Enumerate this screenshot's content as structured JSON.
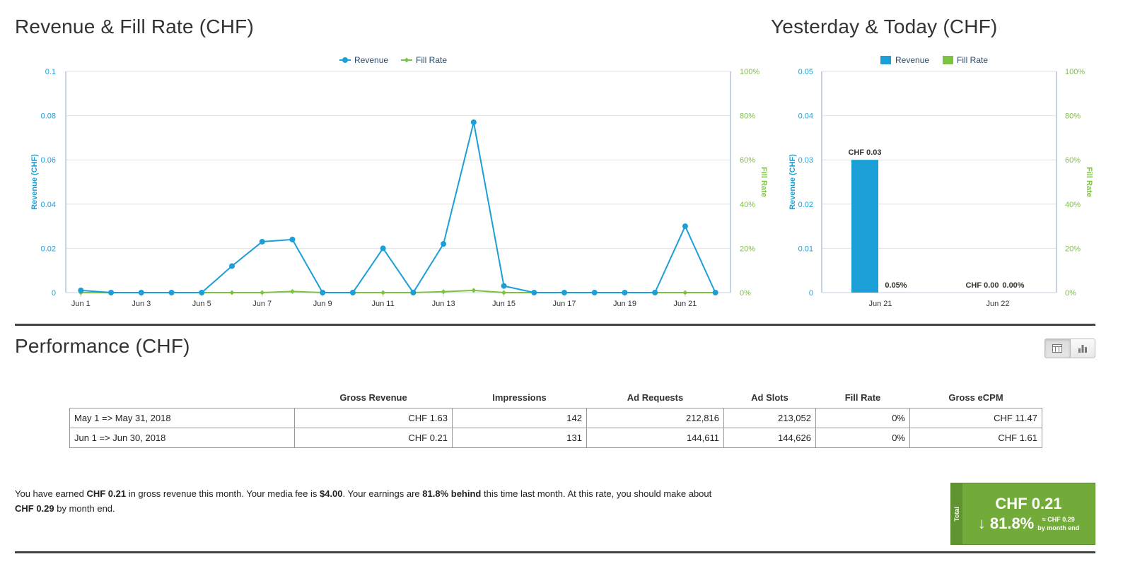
{
  "sections": {
    "revenue_chart_title": "Revenue & Fill Rate (CHF)",
    "yesterday_chart_title": "Yesterday & Today (CHF)",
    "performance_title": "Performance (CHF)"
  },
  "chart_data": [
    {
      "type": "line",
      "title": "Revenue & Fill Rate (CHF)",
      "x": [
        "Jun 1",
        "Jun 2",
        "Jun 3",
        "Jun 4",
        "Jun 5",
        "Jun 6",
        "Jun 7",
        "Jun 8",
        "Jun 9",
        "Jun 10",
        "Jun 11",
        "Jun 12",
        "Jun 13",
        "Jun 14",
        "Jun 15",
        "Jun 16",
        "Jun 17",
        "Jun 18",
        "Jun 19",
        "Jun 20",
        "Jun 21",
        "Jun 22"
      ],
      "x_tick_labels": [
        "Jun 1",
        "Jun 3",
        "Jun 5",
        "Jun 7",
        "Jun 9",
        "Jun 11",
        "Jun 13",
        "Jun 15",
        "Jun 17",
        "Jun 19",
        "Jun 21"
      ],
      "series": [
        {
          "name": "Revenue",
          "axis": "left",
          "color": "#1c9fd7",
          "values": [
            0.001,
            0,
            0,
            0,
            0,
            0.012,
            0.023,
            0.024,
            0,
            0,
            0.02,
            0,
            0.022,
            0.077,
            0.003,
            0,
            0,
            0,
            0,
            0,
            0.03,
            0
          ]
        },
        {
          "name": "Fill Rate",
          "axis": "right",
          "color": "#7dc243",
          "values": [
            0,
            0,
            0,
            0,
            0,
            0,
            0,
            0.5,
            0,
            0,
            0,
            0,
            0.4,
            1.0,
            0,
            0,
            0,
            0,
            0,
            0,
            0,
            0
          ]
        }
      ],
      "ylabel": "Revenue (CHF)",
      "ylim": [
        0,
        0.1
      ],
      "y_tick_labels": [
        "0",
        "0.02",
        "0.04",
        "0.06",
        "0.08",
        "0.1"
      ],
      "y2label": "Fill Rate",
      "y2lim": [
        0,
        100
      ],
      "y2_tick_labels": [
        "0%",
        "20%",
        "40%",
        "60%",
        "80%",
        "100%"
      ],
      "grid": true,
      "legend_position": "top-center"
    },
    {
      "type": "bar",
      "title": "Yesterday & Today (CHF)",
      "categories": [
        "Jun 21",
        "Jun 22"
      ],
      "series": [
        {
          "name": "Revenue",
          "axis": "left",
          "color": "#1c9fd7",
          "values": [
            0.03,
            0.0
          ],
          "labels": [
            "CHF 0.03",
            "CHF 0.00"
          ]
        },
        {
          "name": "Fill Rate",
          "axis": "right",
          "color": "#7dc243",
          "values": [
            0.05,
            0.0
          ],
          "labels": [
            "0.05%",
            "0.00%"
          ]
        }
      ],
      "ylabel": "Revenue (CHF)",
      "ylim": [
        0,
        0.05
      ],
      "y_tick_labels": [
        "0",
        "0.01",
        "0.02",
        "0.03",
        "0.04",
        "0.05"
      ],
      "y2label": "Fill Rate",
      "y2lim": [
        0,
        100
      ],
      "y2_tick_labels": [
        "0%",
        "20%",
        "40%",
        "60%",
        "80%",
        "100%"
      ],
      "grid": true,
      "legend_position": "top-center"
    }
  ],
  "performance_table": {
    "headers": [
      "",
      "Gross Revenue",
      "Impressions",
      "Ad Requests",
      "Ad Slots",
      "Fill Rate",
      "Gross eCPM"
    ],
    "rows": [
      [
        "May 1 => May 31, 2018",
        "CHF 1.63",
        "142",
        "212,816",
        "213,052",
        "0%",
        "CHF 11.47"
      ],
      [
        "Jun 1 => Jun 30, 2018",
        "CHF 0.21",
        "131",
        "144,611",
        "144,626",
        "0%",
        "CHF 1.61"
      ]
    ]
  },
  "summary": {
    "t1": "You have earned ",
    "earned": "CHF 0.21",
    "t2": " in gross revenue this month. Your media fee is ",
    "fee": "$4.00",
    "t3": ". Your earnings are ",
    "behind": "81.8% behind",
    "t4": " this time last month. At this rate, you should make about ",
    "projection": "CHF 0.29",
    "t5": " by month end."
  },
  "total_box": {
    "side_label": "Total",
    "amount": "CHF 0.21",
    "change": "↓ 81.8%",
    "projection_line1": "≈ CHF 0.29",
    "projection_line2": "by month end"
  },
  "view_toggle": {
    "active": "table"
  },
  "icons": [
    "table-view-icon",
    "bar-chart-view-icon"
  ]
}
